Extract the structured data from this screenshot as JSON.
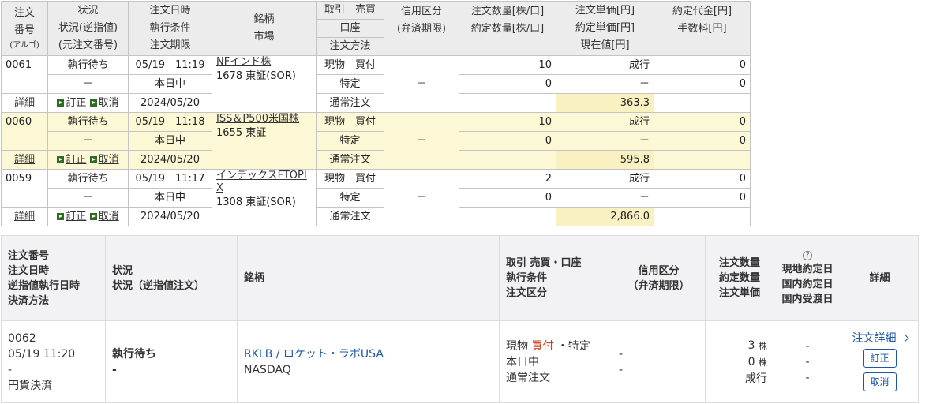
{
  "legacy_table": {
    "headers": {
      "order_no": [
        "注文",
        "番号",
        "(アルゴ)"
      ],
      "status": [
        "状況",
        "状況(逆指値)",
        "(元注文番号)"
      ],
      "order_time": [
        "注文日時",
        "執行条件",
        "注文期限"
      ],
      "symbol": [
        "銘柄",
        "市場"
      ],
      "trade": [
        "取引　売買",
        "口座",
        "注文方法"
      ],
      "margin": [
        "信用区分",
        "(弁済期限)"
      ],
      "quantity": [
        "注文数量[株/口]",
        "約定数量[株/口]"
      ],
      "price": [
        "注文単価[円]",
        "約定単価[円]",
        "現在値[円]"
      ],
      "amount": [
        "約定代金[円]",
        "手数料[円]"
      ]
    },
    "rows": [
      {
        "order_no": "0061",
        "detail": "詳細",
        "status": "執行待ち",
        "status_sub": "－",
        "correct": "訂正",
        "cancel": "取消",
        "datetime": "05/19　11:19",
        "condition": "本日中",
        "expiry": "2024/05/20",
        "name": "NFインド株",
        "code_market": "1678 東証(SOR)",
        "trade": "現物　買付",
        "account": "特定",
        "method": "通常注文",
        "margin": "－",
        "qty": "10",
        "filled_qty": "0",
        "order_price": "成行",
        "exec_price": "－",
        "current_price": "363.3",
        "amount": "0",
        "fee": "0"
      },
      {
        "order_no": "0060",
        "detail": "詳細",
        "status": "執行待ち",
        "status_sub": "－",
        "correct": "訂正",
        "cancel": "取消",
        "datetime": "05/19　11:18",
        "condition": "本日中",
        "expiry": "2024/05/20",
        "name": "ISS＆P500米国株",
        "code_market": "1655 東証",
        "trade": "現物　買付",
        "account": "特定",
        "method": "通常注文",
        "margin": "－",
        "qty": "10",
        "filled_qty": "0",
        "order_price": "成行",
        "exec_price": "－",
        "current_price": "595.8",
        "amount": "0",
        "fee": "0"
      },
      {
        "order_no": "0059",
        "detail": "詳細",
        "status": "執行待ち",
        "status_sub": "－",
        "correct": "訂正",
        "cancel": "取消",
        "datetime": "05/19　11:17",
        "condition": "本日中",
        "expiry": "2024/05/20",
        "name": "インデックスFTOPIX",
        "code_market": "1308 東証(SOR)",
        "trade": "現物　買付",
        "account": "特定",
        "method": "通常注文",
        "margin": "－",
        "qty": "2",
        "filled_qty": "0",
        "order_price": "成行",
        "exec_price": "－",
        "current_price": "2,866.0",
        "amount": "0",
        "fee": "0"
      }
    ]
  },
  "us_table": {
    "headers": {
      "order": [
        "注文番号",
        "注文日時",
        "逆指値執行日時",
        "決済方法"
      ],
      "status": [
        "状況",
        "状況（逆指値注文）"
      ],
      "symbol": "銘柄",
      "trade": [
        "取引 売買・口座",
        "執行条件",
        "注文区分"
      ],
      "margin": [
        "信用区分",
        "（弁済期限）"
      ],
      "quantity": [
        "注文数量",
        "約定数量",
        "注文単価"
      ],
      "dates": [
        "現地約定日",
        "国内約定日",
        "国内受渡日"
      ],
      "detail": "詳細",
      "help_icon_glyph": "?"
    },
    "row": {
      "order_no": "0062",
      "datetime": "05/19 11:20",
      "stop_exec": "-",
      "settlement": "円貨決済",
      "status": "執行待ち",
      "status_sub": "-",
      "symbol": "RKLB / ロケット・ラボUSA",
      "market": "NASDAQ",
      "trade_type": "現物",
      "side": "買付",
      "account": "・特定",
      "condition": "本日中",
      "order_type": "通常注文",
      "margin_1": "-",
      "margin_2": "-",
      "qty": "3",
      "qty_unit": "株",
      "filled": "0",
      "filled_unit": "株",
      "unit_price": "成行",
      "local_date": "-",
      "domestic_date": "-",
      "delivery_date": "-",
      "detail_link": "注文詳細",
      "correct": "訂正",
      "cancel": "取消"
    },
    "colors": {
      "link": "#1e57a6",
      "buy": "#d23b1c"
    }
  }
}
